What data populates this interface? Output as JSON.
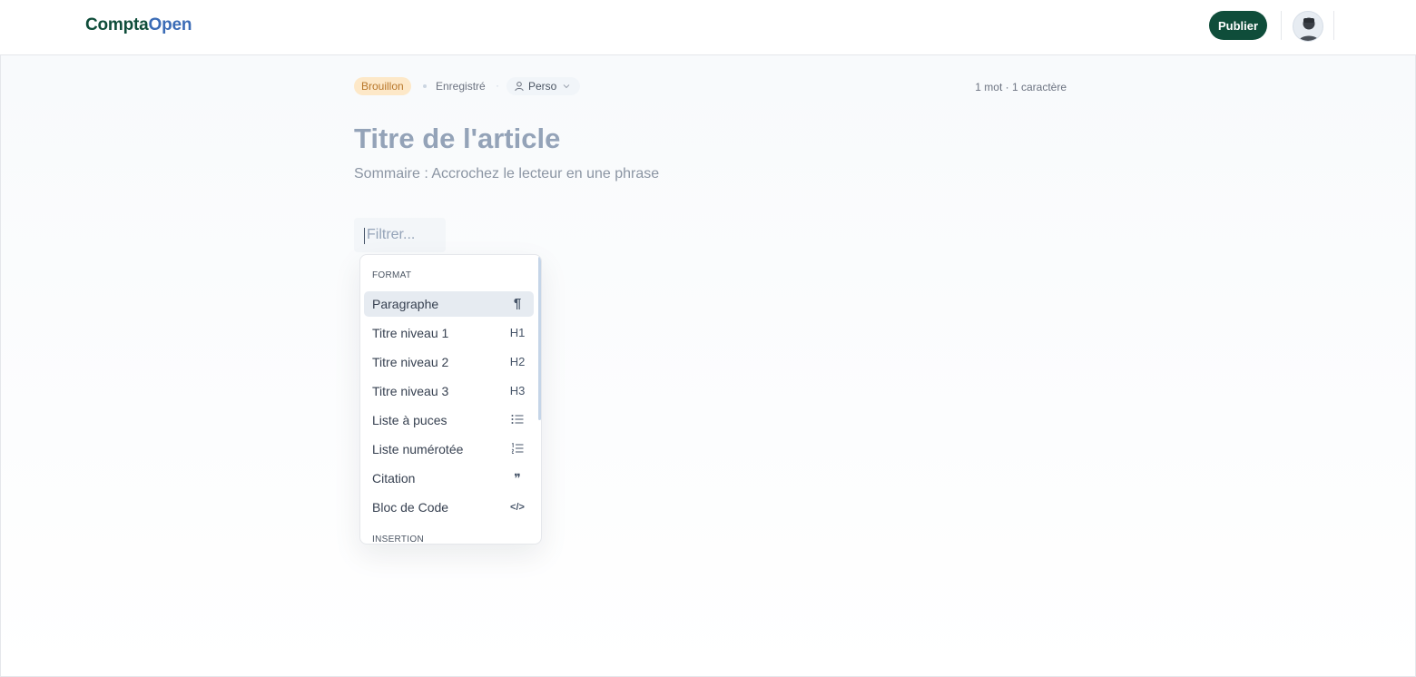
{
  "header": {
    "logo_part1": "Compta",
    "logo_part2": "Open",
    "publish_label": "Publier"
  },
  "editor": {
    "status_badge": "Brouillon",
    "saved_label": "Enregistré",
    "separator": "·",
    "visibility_label": "Perso",
    "word_count": "1 mot",
    "count_separator": " · ",
    "char_count": "1 caractère",
    "title_placeholder": "Titre de l'article",
    "summary_placeholder": "Sommaire : Accrochez le lecteur en une phrase",
    "filter_placeholder": "Filtrer..."
  },
  "menu": {
    "format_label": "FORMAT",
    "insertion_label": "INSERTION",
    "items": [
      {
        "label": "Paragraphe",
        "icon": "pilcrow-icon",
        "glyph": "¶",
        "active": true
      },
      {
        "label": "Titre niveau 1",
        "icon": "heading1-icon",
        "glyph": "H1"
      },
      {
        "label": "Titre niveau 2",
        "icon": "heading2-icon",
        "glyph": "H2"
      },
      {
        "label": "Titre niveau 3",
        "icon": "heading3-icon",
        "glyph": "H3"
      },
      {
        "label": "Liste à puces",
        "icon": "bullet-list-icon"
      },
      {
        "label": "Liste numérotée",
        "icon": "numbered-list-icon"
      },
      {
        "label": "Citation",
        "icon": "quote-icon",
        "glyph": "❞"
      },
      {
        "label": "Bloc de Code",
        "icon": "code-icon",
        "glyph": "</>"
      }
    ]
  },
  "colors": {
    "brand_green": "#0f4d3a",
    "brand_blue": "#3b6cb6",
    "draft_badge_bg": "#fde8c8",
    "draft_badge_text": "#b8772a"
  }
}
